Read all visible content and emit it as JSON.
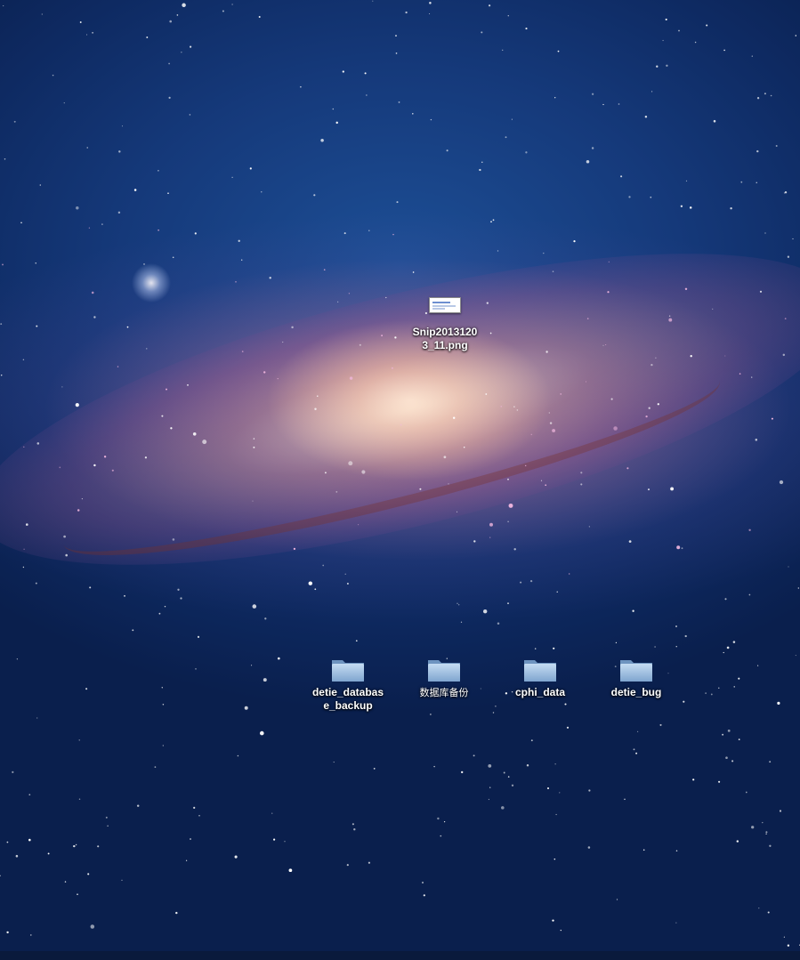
{
  "desktop": {
    "wallpaper": "andromeda-galaxy",
    "colors": {
      "space": "#15397a",
      "label_text": "#ffffff",
      "folder_blue": "#8fb3d9"
    },
    "files": [
      {
        "name": "Snip20131203_11.png",
        "label_line1": "Snip2013120",
        "label_line2": "3_11.png",
        "icon": "png-image-icon"
      }
    ],
    "folders": [
      {
        "name": "detie_database_backup",
        "label_line1": "detie_databas",
        "label_line2": "e_backup",
        "icon": "folder-icon"
      },
      {
        "name": "数据库备份",
        "label_line1": "数据库备份",
        "label_line2": "",
        "icon": "folder-icon"
      },
      {
        "name": "cphi_data",
        "label_line1": "cphi_data",
        "label_line2": "",
        "icon": "folder-icon"
      },
      {
        "name": "detie_bug",
        "label_line1": "detie_bug",
        "label_line2": "",
        "icon": "folder-icon"
      }
    ]
  }
}
